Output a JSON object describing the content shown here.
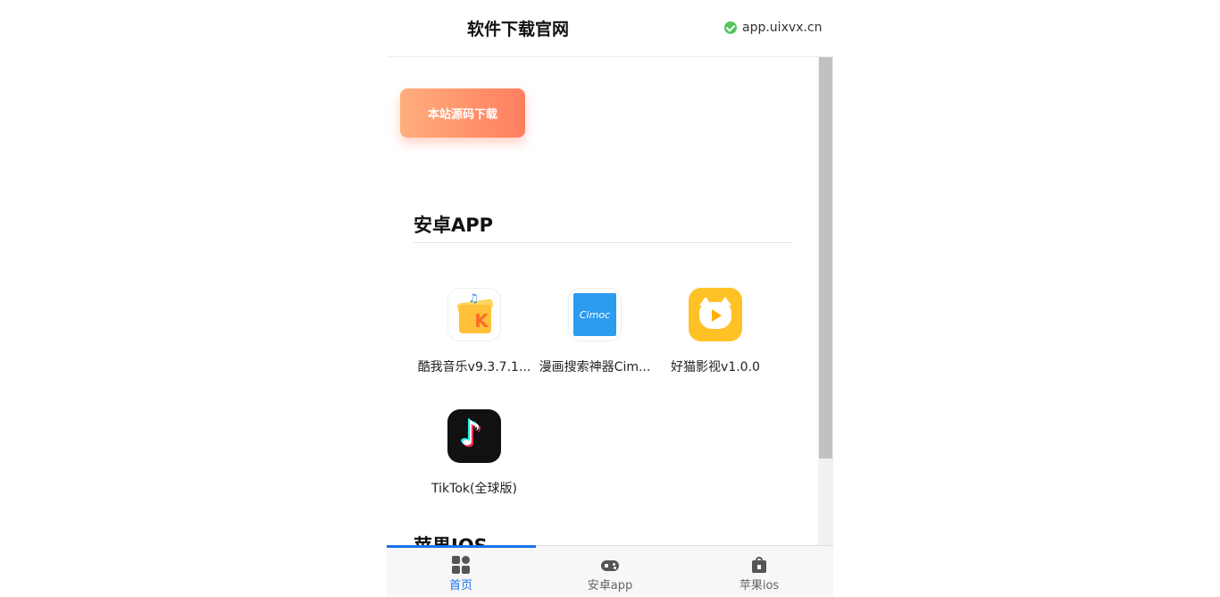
{
  "header": {
    "title": "软件下载官网",
    "site": "app.uixvx.cn"
  },
  "main": {
    "source_button": "本站源码下载",
    "android_section": {
      "title": "安卓APP",
      "apps": [
        {
          "name": "酷我音乐v9.3.7.1...",
          "icon": "kuwo-icon"
        },
        {
          "name": "漫画搜索神器Cim...",
          "icon": "cimoc-icon",
          "icon_text": "Cimoc"
        },
        {
          "name": "好猫影视v1.0.0",
          "icon": "haomao-icon"
        },
        {
          "name": "TikTok(全球版)",
          "icon": "tiktok-icon"
        }
      ]
    },
    "ios_section": {
      "title": "苹果IOS"
    }
  },
  "tabbar": {
    "tabs": [
      {
        "label": "首页",
        "icon": "home-grid-icon",
        "active": true
      },
      {
        "label": "安卓app",
        "icon": "gamepad-icon",
        "active": false
      },
      {
        "label": "苹果ios",
        "icon": "bag-lock-icon",
        "active": false
      }
    ]
  },
  "colors": {
    "accent": "#1a73e8",
    "button_gradient_start": "#ffae7c",
    "button_gradient_end": "#ff7e5f",
    "check": "#52c45c"
  }
}
